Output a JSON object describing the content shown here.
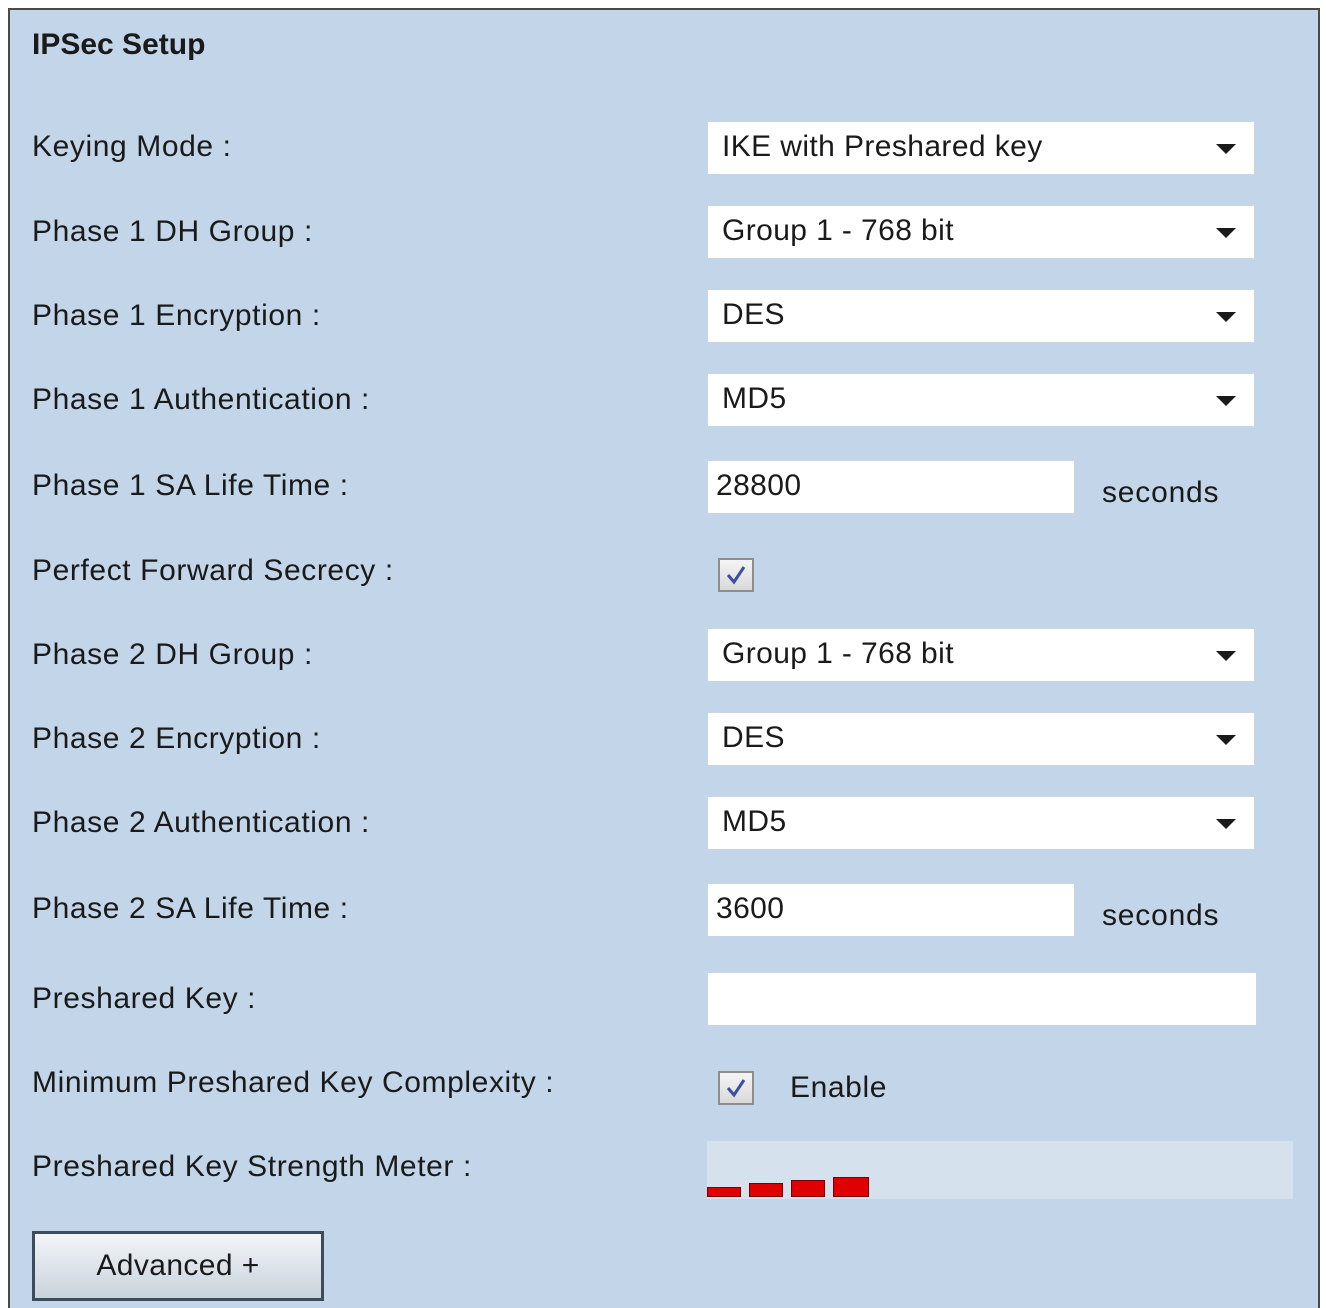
{
  "section": {
    "title": "IPSec Setup"
  },
  "fields": {
    "keying_mode": {
      "label": "Keying Mode :",
      "value": "IKE with Preshared key"
    },
    "phase1_dh_group": {
      "label": "Phase 1 DH Group :",
      "value": "Group 1 - 768 bit"
    },
    "phase1_encryption": {
      "label": "Phase 1 Encryption :",
      "value": "DES"
    },
    "phase1_authentication": {
      "label": "Phase 1 Authentication :",
      "value": "MD5"
    },
    "phase1_sa_life_time": {
      "label": "Phase 1 SA Life Time :",
      "value": "28800",
      "unit": "seconds"
    },
    "perfect_forward_secrecy": {
      "label": "Perfect Forward Secrecy :",
      "checked": true
    },
    "phase2_dh_group": {
      "label": "Phase 2 DH Group :",
      "value": "Group 1 - 768 bit"
    },
    "phase2_encryption": {
      "label": "Phase 2 Encryption :",
      "value": "DES"
    },
    "phase2_authentication": {
      "label": "Phase 2 Authentication :",
      "value": "MD5"
    },
    "phase2_sa_life_time": {
      "label": "Phase 2 SA Life Time :",
      "value": "3600",
      "unit": "seconds"
    },
    "preshared_key": {
      "label": "Preshared Key :",
      "value": ""
    },
    "min_key_complexity": {
      "label": "Minimum Preshared Key Complexity :",
      "checked": true,
      "option_label": "Enable"
    },
    "strength_meter": {
      "label": "Preshared Key Strength Meter :",
      "bars": 4,
      "bar_color": "#e00000"
    }
  },
  "buttons": {
    "advanced": "Advanced +"
  },
  "icons": {
    "select_arrow": "chevron-down-icon",
    "checkbox_check": "check-icon"
  },
  "colors": {
    "panel_background": "#c3d5e8",
    "meter_background": "#d5e2ee"
  }
}
